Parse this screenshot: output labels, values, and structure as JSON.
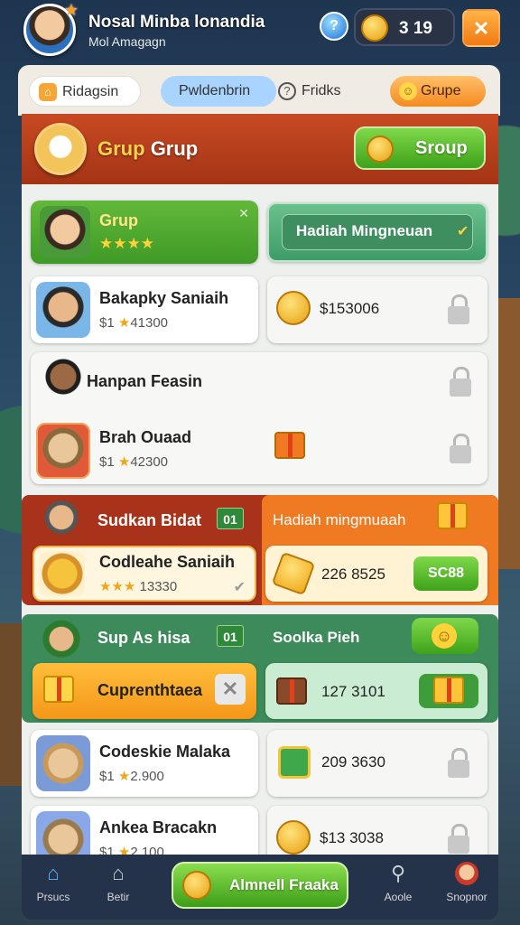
{
  "profile": {
    "name": "Nosal Minba lonandia",
    "subtitle": "Mol Amagagn",
    "gem_glyph": "?",
    "coins": "3 19"
  },
  "tabs": [
    {
      "label": "Ridagsin"
    },
    {
      "label": "Pwldenbrin"
    },
    {
      "label": "Fridks"
    },
    {
      "label": "Grupe"
    }
  ],
  "header": {
    "title_a": "Grup",
    "title_b": "Grup",
    "button": "Sroup"
  },
  "rows": {
    "r1": {
      "name": "Grup",
      "stars": "★★★★",
      "right_label": "Hadiah Mingneuan"
    },
    "r2": {
      "name": "Bakapky Saniaih",
      "score_prefix": "$1 ",
      "score": "41300",
      "amount": "$153006"
    },
    "r3": {
      "name": "Hanpan Feasin"
    },
    "r4": {
      "name": "Brah Ouaad",
      "score_prefix": "$1 ",
      "score": "42300"
    },
    "r5": {
      "name": "Sudkan Bidat",
      "badge": "01",
      "right_label": "Hadiah mingmuaah"
    },
    "r6": {
      "name": "Codleahe Saniaih",
      "stars": "★★★",
      "score": "13330",
      "amount": "226 8525",
      "button": "SC88"
    },
    "r7": {
      "name": "Sup As hisa",
      "badge": "01",
      "right_label": "Soolka Pieh"
    },
    "r8": {
      "name": "Cuprenthtaea",
      "amount": "127 3101"
    },
    "r9": {
      "name": "Codeskie Malaka",
      "score_prefix": "$1 ",
      "score": "2.900",
      "amount": "209 3630"
    },
    "r10": {
      "name": "Ankea Bracakn",
      "score_prefix": "$1 ",
      "score": "2.100",
      "amount": "$13 3038"
    }
  },
  "nav": {
    "items": [
      "Prsucs",
      "Betir",
      "Aoole",
      "Snopnor"
    ],
    "cta": "Almnell Fraaka"
  },
  "colors": {
    "header_red": "#b53a1a",
    "green_button": "#4caf2a",
    "orange_button": "#f48a20",
    "nav_bg": "#24324a"
  }
}
